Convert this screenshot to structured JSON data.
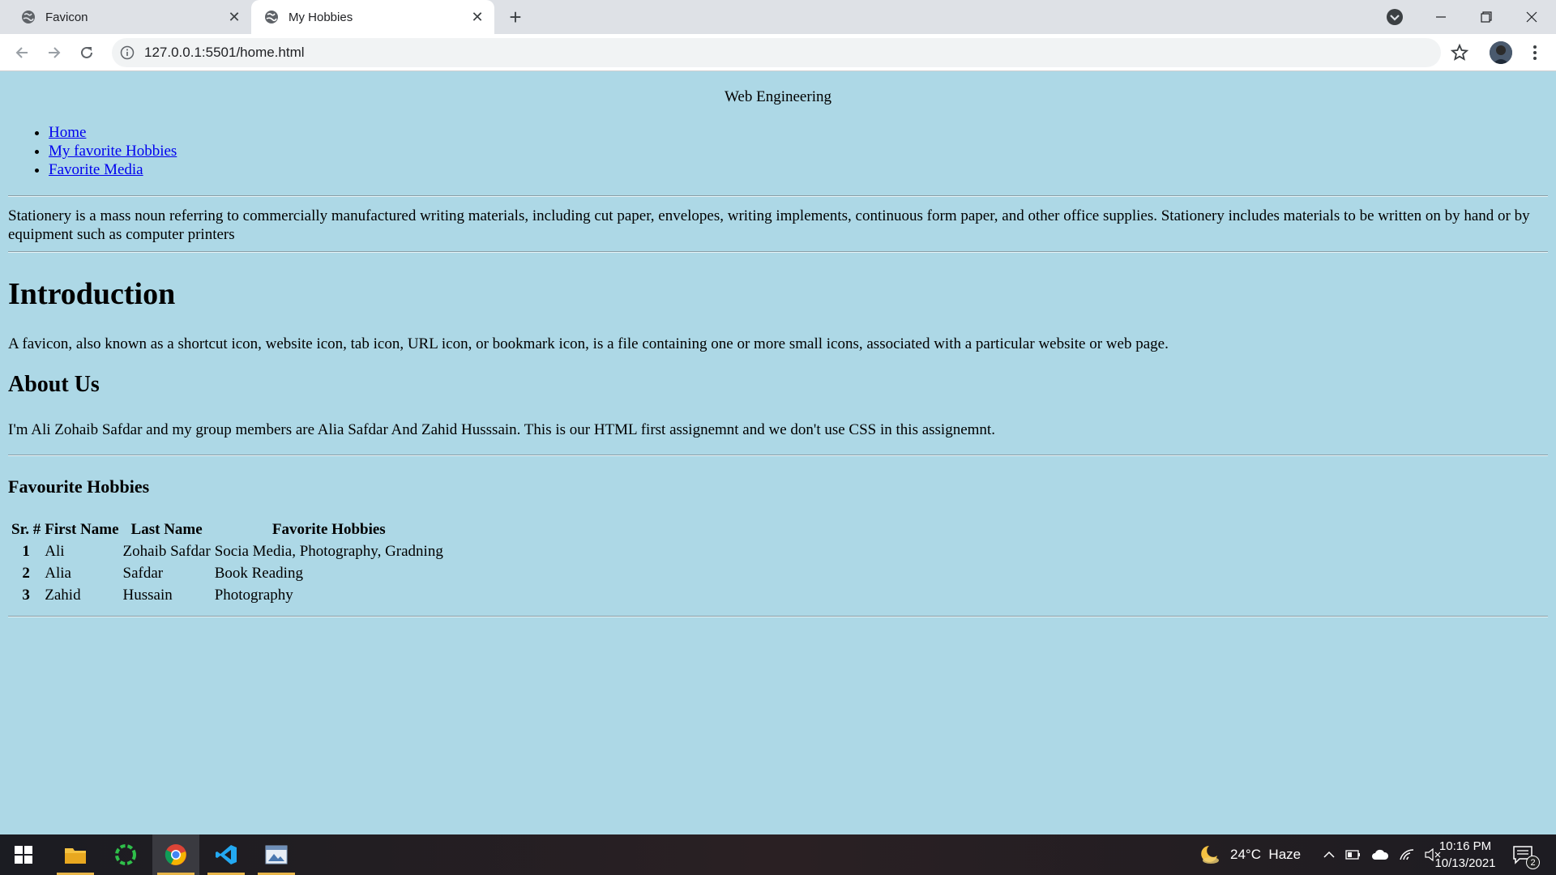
{
  "browser": {
    "tabs": [
      {
        "label": "Favicon",
        "active": false
      },
      {
        "label": "My Hobbies",
        "active": true
      }
    ],
    "url": "127.0.0.1:5501/home.html"
  },
  "page": {
    "site_title": "Web Engineering",
    "nav": [
      "Home",
      "My favorite Hobbies",
      "Favorite Media"
    ],
    "stationery_text": "Stationery is a mass noun referring to commercially manufactured writing materials, including cut paper, envelopes, writing implements, continuous form paper, and other office supplies. Stationery includes materials to be written on by hand or by equipment such as computer printers",
    "intro_heading": "Introduction",
    "intro_text": "A favicon, also known as a shortcut icon, website icon, tab icon, URL icon, or bookmark icon, is a file containing one or more small icons, associated with a particular website or web page.",
    "about_heading": "About Us",
    "about_text": "I'm Ali Zohaib Safdar and my group members are Alia Safdar And Zahid Husssain. This is our HTML first assignemnt and we don't use CSS in this assignemnt.",
    "hobbies_heading": "Favourite Hobbies",
    "table": {
      "headers": [
        "Sr. #",
        "First Name",
        "Last Name",
        "Favorite Hobbies"
      ],
      "rows": [
        [
          "1",
          "Ali",
          "Zohaib Safdar",
          "Socia Media, Photography, Gradning"
        ],
        [
          "2",
          "Alia",
          "Safdar",
          "Book Reading"
        ],
        [
          "3",
          "Zahid",
          "Hussain",
          "Photography"
        ]
      ]
    }
  },
  "taskbar": {
    "weather": "24°C  Haze",
    "time": "10:16 PM",
    "date": "10/13/2021",
    "notification_count": "2",
    "icons": [
      "windows-start-icon",
      "file-explorer-icon",
      "circle-app-icon",
      "chrome-icon",
      "vscode-icon",
      "photos-app-icon"
    ]
  },
  "colors": {
    "page_background": "#add8e6",
    "link": "#0000ee",
    "tabbar": "#dee1e6"
  }
}
